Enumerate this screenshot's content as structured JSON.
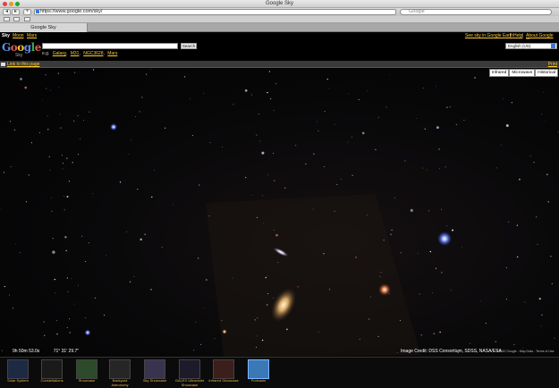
{
  "browser": {
    "window_title": "Google Sky",
    "url": "https://www.google.com/sky/",
    "search_placeholder": "Google",
    "tab_title": "Google Sky",
    "nav_add": "+",
    "nav_back": "◂",
    "nav_forward": "▸"
  },
  "sky_nav": {
    "items": [
      "Sky",
      "Moon",
      "Mars"
    ],
    "right_links": [
      "See sky in Google Earth",
      "Help",
      "About Google Sky"
    ],
    "separator": "|"
  },
  "header": {
    "logo_letters": [
      "G",
      "o",
      "o",
      "g",
      "l",
      "e"
    ],
    "logo_sub": "Sky",
    "search_value": "",
    "search_button": "Search",
    "examples_prefix": "e.g.",
    "examples": [
      "Galaxy",
      "M31",
      "NGC3628",
      "Mars"
    ],
    "language": "English (US)"
  },
  "linkbar": {
    "link_label": "Link to this page",
    "print_label": "Print"
  },
  "layers": [
    "Infrared",
    "Microwave",
    "Historical"
  ],
  "status": {
    "ra": "9h 50m 53.0s",
    "dec": "71° 31' 29.7\"",
    "credit": "Image Credit: DSS Consortium, SDSS, NASA/ESA",
    "terms": "©2010 Google - Map Data - Terms of Use"
  },
  "showcase": [
    {
      "label": "Solar System",
      "color": "#1c2a44"
    },
    {
      "label": "Constellations",
      "color": "#1a1a1a"
    },
    {
      "label": "Showcase",
      "color": "#2d4a2a"
    },
    {
      "label": "Backyard Astronomy",
      "color": "#262626"
    },
    {
      "label": "Sky Showcase",
      "color": "#3a3350"
    },
    {
      "label": "GALEX Ultraviolet Showcase",
      "color": "#1d1a2a"
    },
    {
      "label": "Infrared Showcase",
      "color": "#3c1f1a"
    },
    {
      "label": "Podcasts",
      "color": "#3a79b5"
    }
  ],
  "colors": {
    "link": "#ffcc33",
    "sky_background": "#050506"
  }
}
